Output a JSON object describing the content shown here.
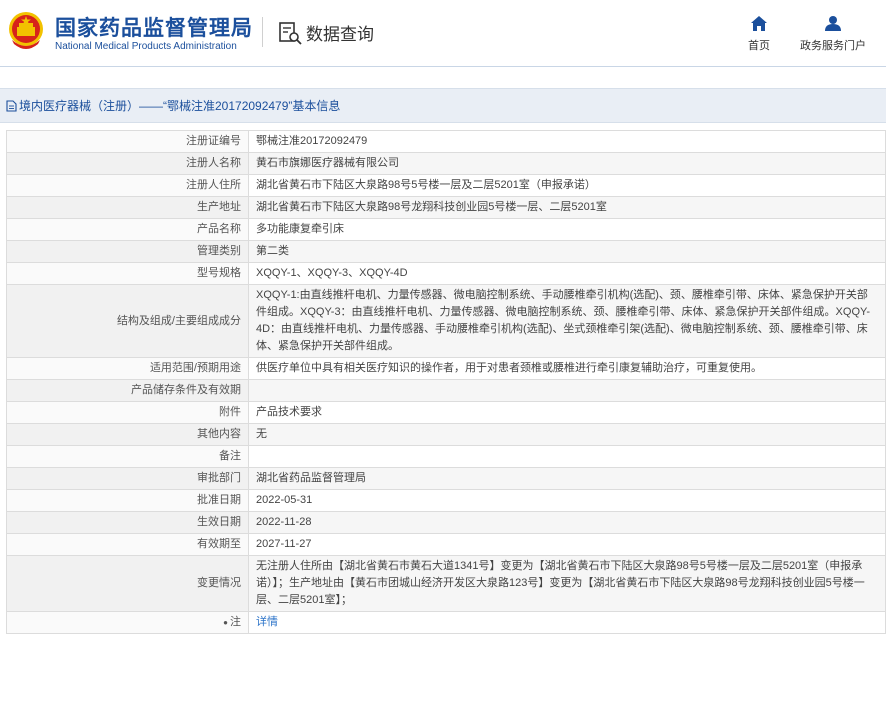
{
  "header": {
    "org_cn": "国家药品监督管理局",
    "org_en": "National Medical Products Administration",
    "query_label": "数据查询",
    "nav": [
      {
        "label": "首页",
        "icon": "home-icon"
      },
      {
        "label": "政务服务门户",
        "icon": "user-icon"
      }
    ]
  },
  "breadcrumb": {
    "text": "境内医疗器械（注册）——“鄂械注准20172092479”基本信息"
  },
  "colors": {
    "brand": "#1b4f9c",
    "link": "#2a72c8",
    "logo_red": "#d7231a",
    "logo_gold": "#f2c200"
  },
  "rows": [
    {
      "label": "注册证编号",
      "value": "鄂械注准20172092479"
    },
    {
      "label": "注册人名称",
      "value": "黄石市旗娜医疗器械有限公司"
    },
    {
      "label": "注册人住所",
      "value": "湖北省黄石市下陆区大泉路98号5号楼一层及二层5201室（申报承诺）"
    },
    {
      "label": "生产地址",
      "value": "湖北省黄石市下陆区大泉路98号龙翔科技创业园5号楼一层、二层5201室"
    },
    {
      "label": "产品名称",
      "value": "多功能康复牵引床"
    },
    {
      "label": "管理类别",
      "value": "第二类"
    },
    {
      "label": "型号规格",
      "value": "XQQY-1、XQQY-3、XQQY-4D"
    },
    {
      "label": "结构及组成/主要组成成分",
      "value": "XQQY-1:由直线推杆电机、力量传感器、微电脑控制系统、手动腰椎牵引机构(选配)、颈、腰椎牵引带、床体、紧急保护开关部件组成。XQQY-3：由直线推杆电机、力量传感器、微电脑控制系统、颈、腰椎牵引带、床体、紧急保护开关部件组成。XQQY-4D：由直线推杆电机、力量传感器、手动腰椎牵引机构(选配)、坐式颈椎牵引架(选配)、微电脑控制系统、颈、腰椎牵引带、床体、紧急保护开关部件组成。"
    },
    {
      "label": "适用范围/预期用途",
      "value": "供医疗单位中具有相关医疗知识的操作者，用于对患者颈椎或腰椎进行牵引康复辅助治疗，可重复使用。"
    },
    {
      "label": "产品储存条件及有效期",
      "value": ""
    },
    {
      "label": "附件",
      "value": "产品技术要求"
    },
    {
      "label": "其他内容",
      "value": "无"
    },
    {
      "label": "备注",
      "value": ""
    },
    {
      "label": "审批部门",
      "value": "湖北省药品监督管理局"
    },
    {
      "label": "批准日期",
      "value": "2022-05-31"
    },
    {
      "label": "生效日期",
      "value": "2022-11-28"
    },
    {
      "label": "有效期至",
      "value": "2027-11-27"
    },
    {
      "label": "变更情况",
      "value": "无注册人住所由【湖北省黄石市黄石大道1341号】变更为【湖北省黄石市下陆区大泉路98号5号楼一层及二层5201室（申报承诺）】；生产地址由【黄石市团城山经济开发区大泉路123号】变更为【湖北省黄石市下陆区大泉路98号龙翔科技创业园5号楼一层、二层5201室】；"
    }
  ],
  "note_row": {
    "label": "注",
    "link": "详情"
  }
}
